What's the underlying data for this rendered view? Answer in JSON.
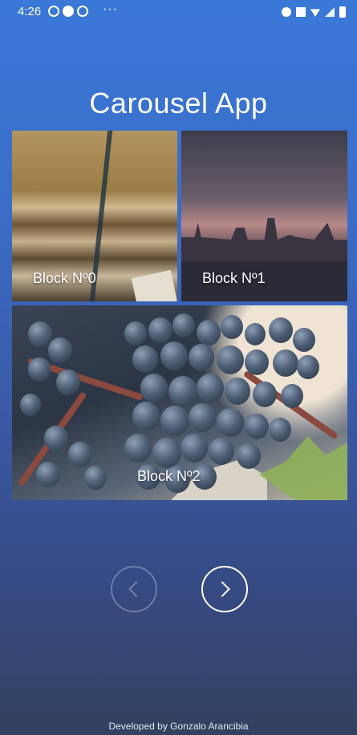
{
  "status_bar": {
    "time": "4:26",
    "more": "···"
  },
  "app": {
    "title": "Carousel App"
  },
  "blocks": [
    {
      "label": "Block Nº0",
      "image": "old-books-tied-with-string"
    },
    {
      "label": "Block Nº1",
      "image": "bridge-silhouette-at-dusk"
    },
    {
      "label": "Block Nº2",
      "image": "dark-grape-bunch"
    }
  ],
  "controls": {
    "prev_icon": "chevron-left-icon",
    "next_icon": "chevron-right-icon",
    "prev_enabled": false,
    "next_enabled": true
  },
  "footer": {
    "credit": "Developed by Gonzalo Arancibia"
  }
}
